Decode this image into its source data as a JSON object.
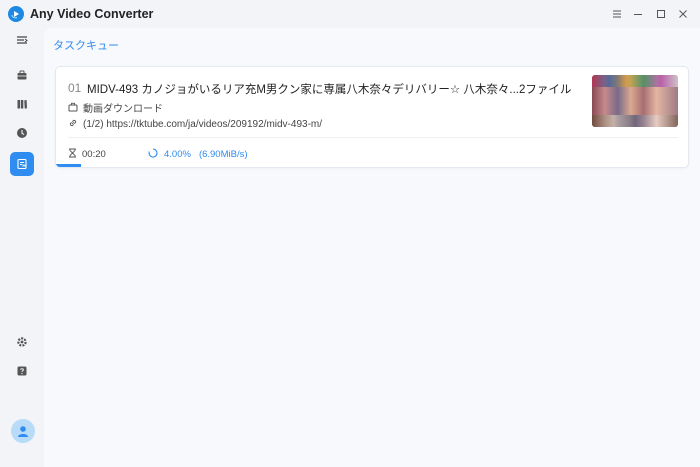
{
  "window": {
    "title": "Any Video Converter"
  },
  "main": {
    "tab_title": "タスクキュー"
  },
  "sidebar": {
    "items": [
      {
        "icon": "menu-toggle-icon"
      },
      {
        "icon": "toolbox-icon"
      },
      {
        "icon": "library-icon"
      },
      {
        "icon": "history-icon"
      },
      {
        "icon": "download-queue-icon",
        "active": true
      },
      {
        "icon": "settings-icon"
      },
      {
        "icon": "help-icon"
      }
    ],
    "avatar_icon": "user-avatar-icon"
  },
  "task": {
    "index": "01",
    "title": "MIDV-493 カノジョがいるリア充M男クン家に専属八木奈々デリバリー☆ 八木奈々...2ファイル",
    "type_label": "動画ダウンロード",
    "source": "(1/2) https://tktube.com/ja/videos/209192/midv-493-m/",
    "elapsed": "00:20",
    "percent": "4.00%",
    "speed": "(6.90MiB/s)",
    "progress": 0.04
  },
  "colors": {
    "accent": "#2f8cf0",
    "sidebar_bg": "#f2f4f8",
    "main_bg": "#f7f9fc"
  }
}
